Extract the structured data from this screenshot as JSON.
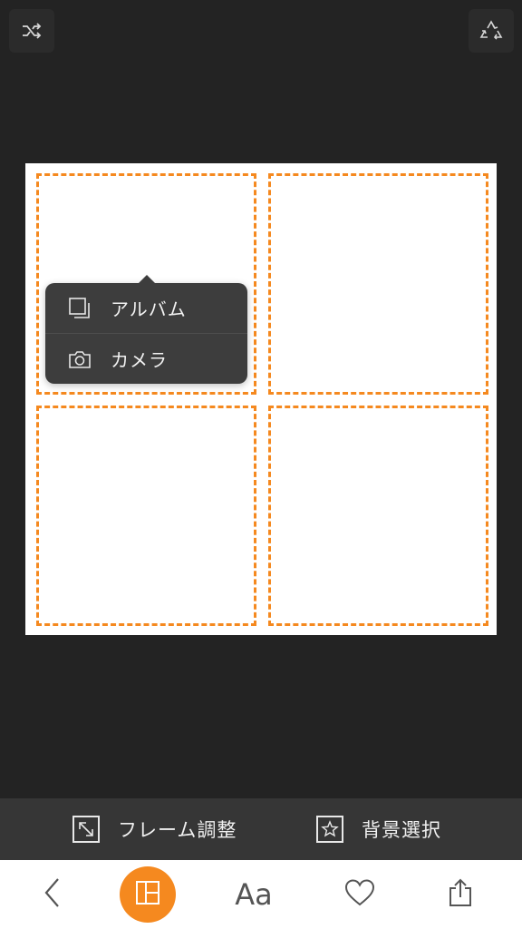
{
  "top": {
    "shuffle_icon": "shuffle-icon",
    "recycle_icon": "recycle-icon"
  },
  "grid": {
    "cells": 4,
    "accent": "#f5891f",
    "background": "#ffffff"
  },
  "popup": {
    "items": [
      {
        "label": "アルバム",
        "icon": "album-icon"
      },
      {
        "label": "カメラ",
        "icon": "camera-icon"
      }
    ]
  },
  "toolbar": {
    "frame_label": "フレーム調整",
    "bg_label": "背景選択"
  },
  "tabbar": {
    "text_label": "Aa",
    "accent": "#f5891f"
  }
}
